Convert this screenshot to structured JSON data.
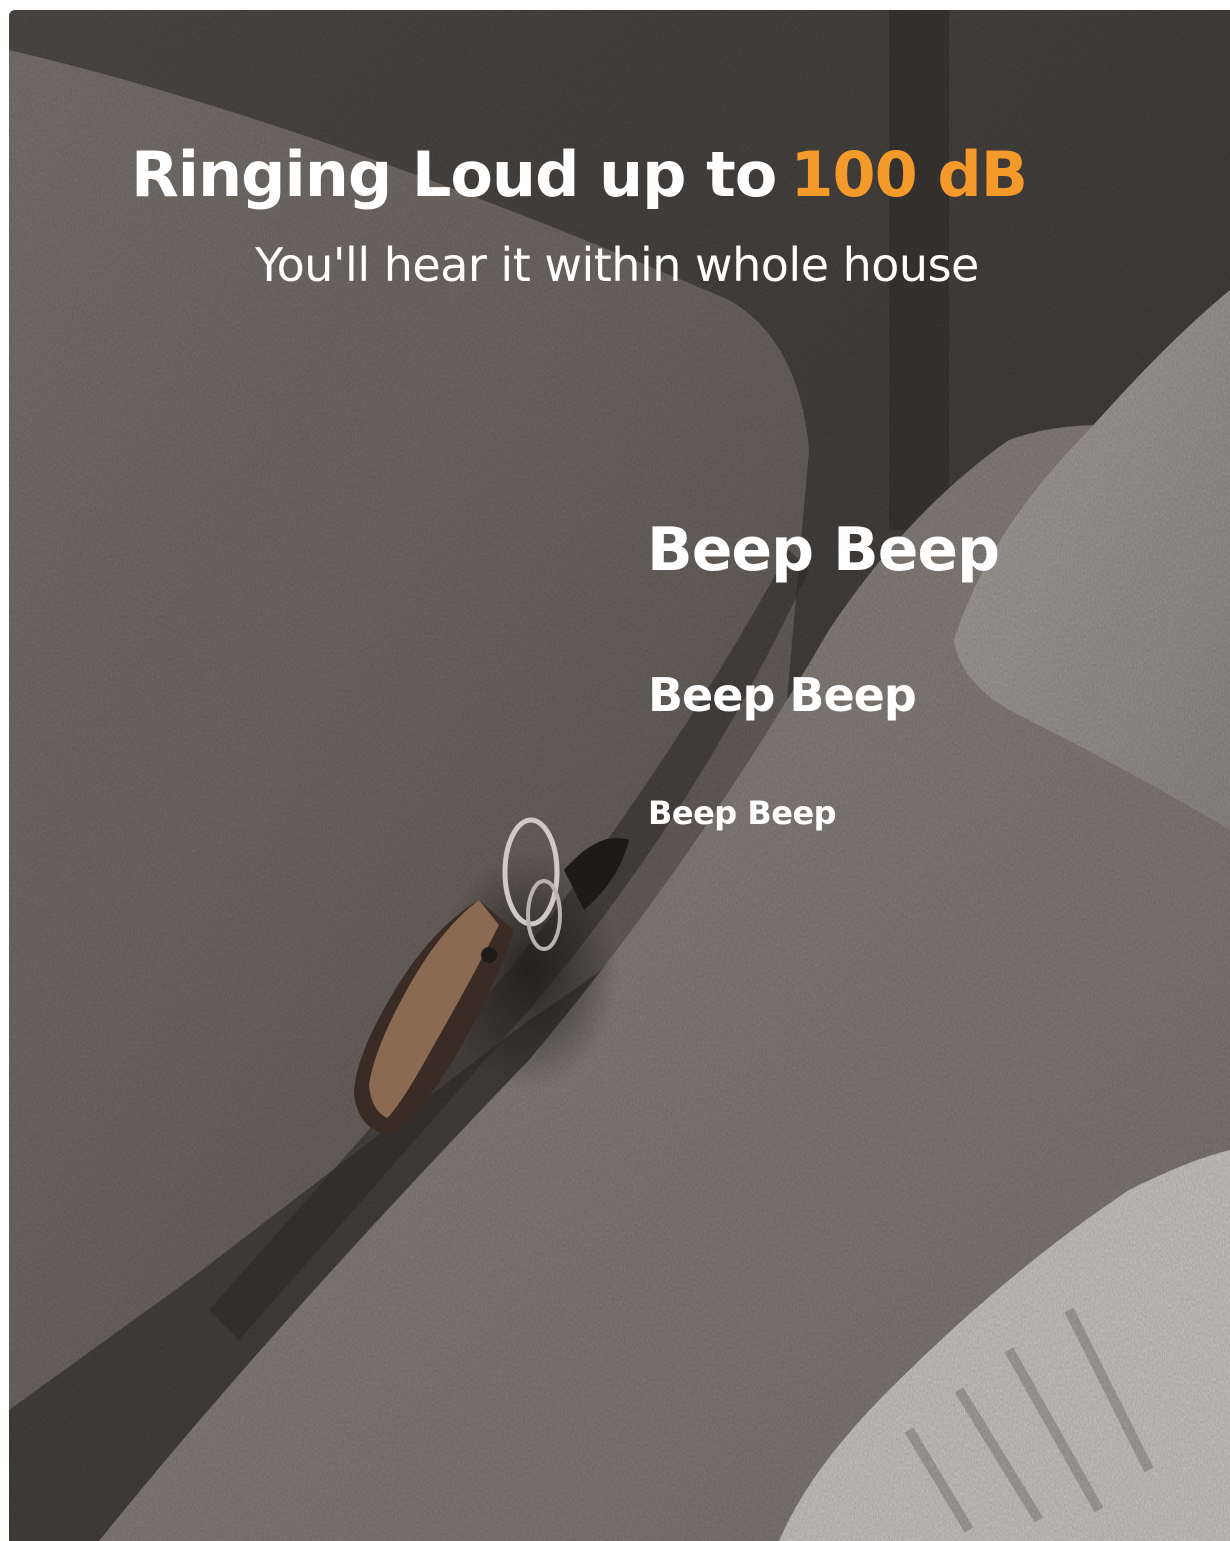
{
  "headline": {
    "main": "Ringing Loud up to",
    "accent": "100 dB",
    "accent_color": "#f39a2b"
  },
  "subheadline": "You'll hear it within whole house",
  "beeps": [
    "Beep Beep",
    "Beep Beep",
    "Beep Beep"
  ],
  "photo": {
    "subject": "keychain with brown leather strap and item tracker wedged between sofa cushions",
    "sofa_color": "#7b756f"
  }
}
